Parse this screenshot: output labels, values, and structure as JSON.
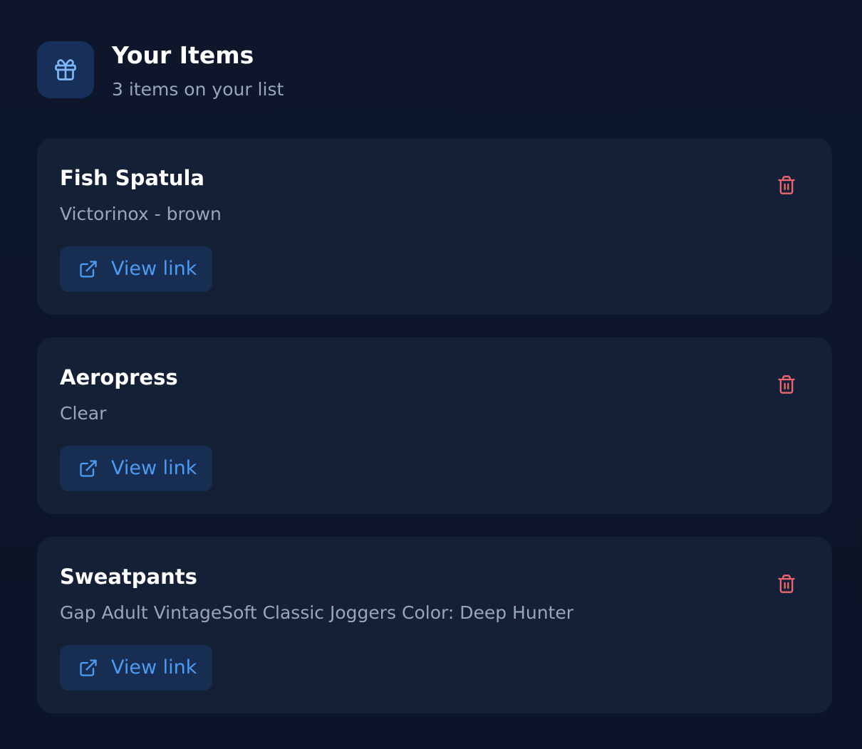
{
  "header": {
    "title": "Your Items",
    "subtitle": "3 items on your list",
    "icon": "gift-icon"
  },
  "items": [
    {
      "name": "Fish Spatula",
      "description": "Victorinox - brown",
      "link_label": "View link",
      "link_icon": "external-link-icon",
      "delete_icon": "trash-icon"
    },
    {
      "name": "Aeropress",
      "description": "Clear",
      "link_label": "View link",
      "link_icon": "external-link-icon",
      "delete_icon": "trash-icon"
    },
    {
      "name": "Sweatpants",
      "description": "Gap Adult VintageSoft Classic Joggers Color: Deep Hunter",
      "link_label": "View link",
      "link_icon": "external-link-icon",
      "delete_icon": "trash-icon"
    }
  ],
  "colors": {
    "background": "#0c1529",
    "card": "#142036",
    "accent_blue": "#4b9cf5",
    "delete_red": "#f0646e",
    "icon_box": "#16305a"
  }
}
